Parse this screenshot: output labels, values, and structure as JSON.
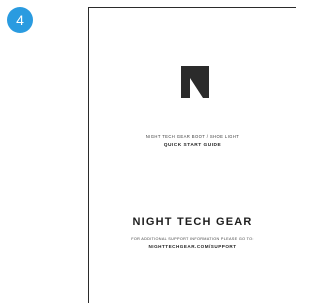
{
  "step": {
    "number": "4",
    "badge_color": "#2a9be0"
  },
  "booklet": {
    "logo_icon": "nighttech-n-logo",
    "product_line": "NIGHT TECH GEAR BOOT / SHOE LIGHT",
    "guide_title": "QUICK START GUIDE",
    "brand_name": "NIGHT TECH GEAR",
    "support_note": "FOR ADDITIONAL SUPPORT INFORMATION PLEASE GO TO:",
    "support_url": "NIGHTTECHGEAR.COM/SUPPORT",
    "ink_color": "#2b2b2b"
  }
}
